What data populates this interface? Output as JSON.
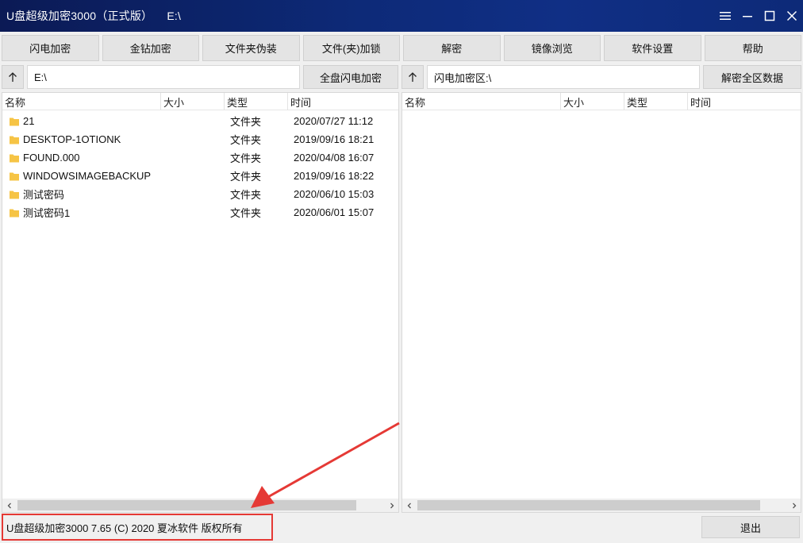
{
  "window": {
    "title": "U盘超级加密3000（正式版）",
    "path": "E:\\"
  },
  "toolbar": {
    "buttons": [
      "闪电加密",
      "金钻加密",
      "文件夹伪装",
      "文件(夹)加锁",
      "解密",
      "镜像浏览",
      "软件设置",
      "帮助"
    ]
  },
  "left_pane": {
    "address": "E:\\",
    "action_label": "全盘闪电加密",
    "columns": [
      "名称",
      "大小",
      "类型",
      "时间"
    ],
    "rows": [
      {
        "name": "21",
        "type": "文件夹",
        "time": "2020/07/27 11:12"
      },
      {
        "name": "DESKTOP-1OTIONK",
        "type": "文件夹",
        "time": "2019/09/16 18:21"
      },
      {
        "name": "FOUND.000",
        "type": "文件夹",
        "time": "2020/04/08 16:07"
      },
      {
        "name": "WINDOWSIMAGEBACKUP",
        "type": "文件夹",
        "time": "2019/09/16 18:22"
      },
      {
        "name": "测试密码",
        "type": "文件夹",
        "time": "2020/06/10 15:03"
      },
      {
        "name": "测试密码1",
        "type": "文件夹",
        "time": "2020/06/01 15:07"
      }
    ]
  },
  "right_pane": {
    "address": "闪电加密区:\\",
    "action_label": "解密全区数据",
    "columns": [
      "名称",
      "大小",
      "类型",
      "时间"
    ]
  },
  "status": {
    "text": "U盘超级加密3000 7.65 (C) 2020 夏冰软件 版权所有"
  },
  "exit_label": "退出",
  "colors": {
    "titlebar": "#0d2a78",
    "annotation": "#e53935",
    "folder": "#f6c445"
  }
}
